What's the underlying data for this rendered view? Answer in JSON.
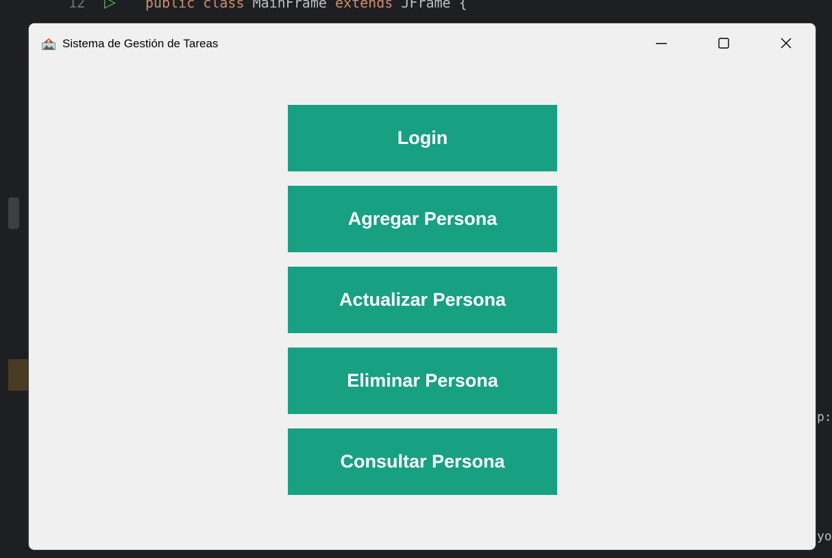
{
  "ide": {
    "line_number": "12",
    "code_keyword_1": "public",
    "code_keyword_2": "class",
    "code_name": "MainFrame",
    "code_keyword_3": "extends",
    "code_super": "JFrame {",
    "edge_text_1": "p:",
    "edge_text_2": "yo"
  },
  "window": {
    "title": "Sistema de Gestión de Tareas",
    "controls": {
      "minimize_icon": "minimize-icon",
      "maximize_icon": "maximize-icon",
      "close_icon": "close-icon"
    }
  },
  "menu": {
    "buttons": [
      {
        "label": "Login"
      },
      {
        "label": "Agregar Persona"
      },
      {
        "label": "Actualizar Persona"
      },
      {
        "label": "Eliminar Persona"
      },
      {
        "label": "Consultar Persona"
      }
    ]
  },
  "colors": {
    "button_bg": "#18a083",
    "button_text": "#ffffff",
    "window_bg": "#f0f0f0"
  }
}
